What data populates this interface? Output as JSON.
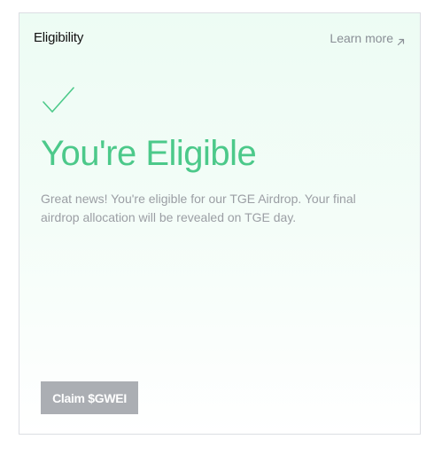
{
  "header": {
    "title": "Eligibility",
    "learn_more_label": "Learn more"
  },
  "icons": {
    "status": "check-icon",
    "learn_more": "arrow-up-right-icon"
  },
  "main": {
    "title": "You're Eligible",
    "description": "Great news! You're eligible for our TGE Airdrop. Your final airdrop allocation will be revealed on TGE day.",
    "claim_button_label": "Claim $GWEI",
    "claim_button_state": "disabled"
  },
  "colors": {
    "accent": "#4cc98a",
    "muted_text": "#9b9ea4",
    "button_disabled": "#abaeb3",
    "card_border": "#dcdee3"
  }
}
